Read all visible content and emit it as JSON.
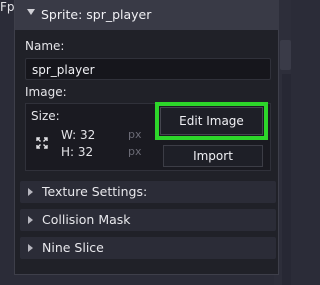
{
  "window": {
    "title": "Sprite: spr_player"
  },
  "background": {
    "partial_label": "Fp"
  },
  "name": {
    "label": "Name:",
    "value": "spr_player"
  },
  "image": {
    "label": "Image:",
    "size_label": "Size:",
    "width_label": "W: 32",
    "height_label": "H: 32",
    "width_unit": "px",
    "height_unit": "px",
    "edit_button": "Edit Image",
    "import_button": "Import"
  },
  "sections": [
    {
      "label": "Texture Settings:"
    },
    {
      "label": "Collision Mask"
    },
    {
      "label": "Nine Slice"
    }
  ],
  "colors": {
    "highlight": "#2dd62a",
    "panel_bg": "#202128",
    "titlebar_bg": "#393a46"
  }
}
